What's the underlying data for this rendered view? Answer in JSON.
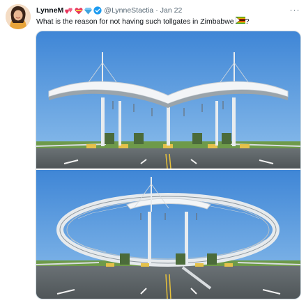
{
  "tweet": {
    "display_name": "LynneM",
    "handle": "@LynneStactia",
    "separator": "·",
    "timestamp": "Jan 22",
    "text": "What is the reason for not having such tollgates in Zimbabwe",
    "text_suffix": "?",
    "name_emojis": [
      "couple-hearts-emoji",
      "heart-ribbon-emoji",
      "blue-diamond-emoji"
    ],
    "verified_badge_color": "#1d9bf0",
    "more_label": "···"
  },
  "colors": {
    "text_primary": "#0f1419",
    "text_secondary": "#536471",
    "border": "#cfd9de",
    "sky": "#4a90d9",
    "road": "#5d6468",
    "grass": "#6e9a4a"
  },
  "media": {
    "images": [
      {
        "subject": "tollgate-canopy-wave-roof"
      },
      {
        "subject": "tollgate-elliptical-steel-arch"
      }
    ]
  }
}
